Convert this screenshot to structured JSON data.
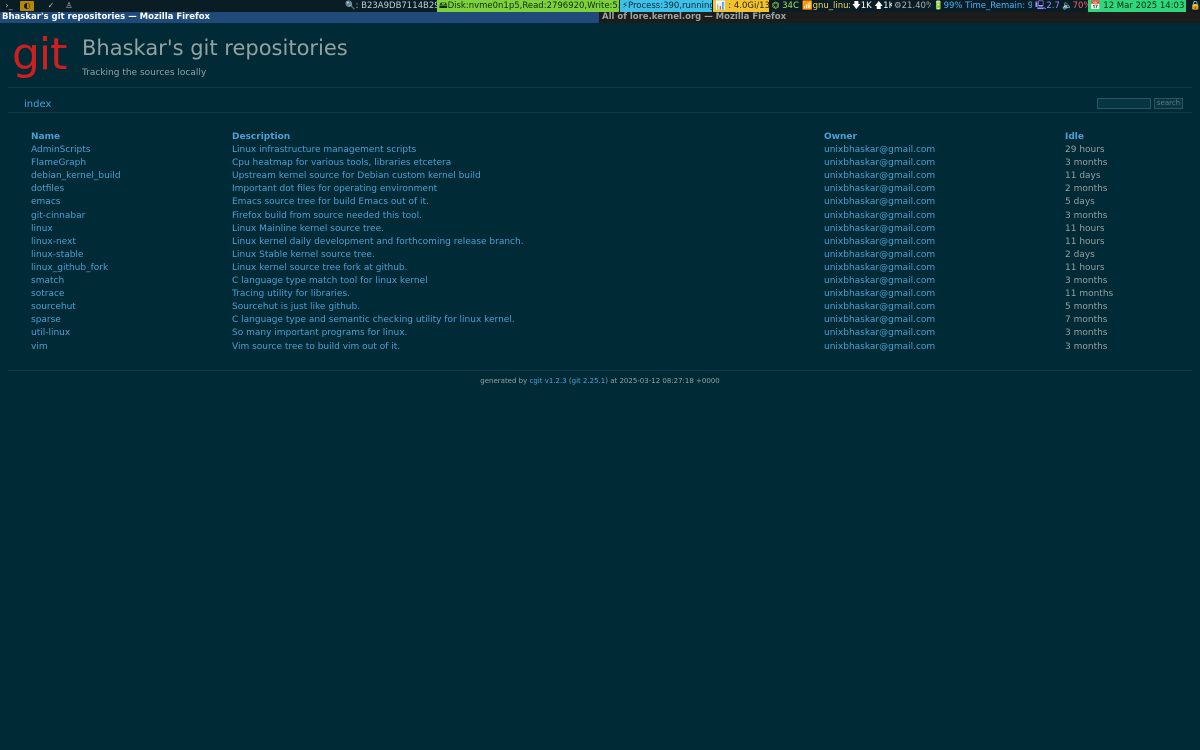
{
  "statusbar": {
    "tags": [
      "›_",
      "◐",
      "✓",
      "♙"
    ],
    "key": "🔍: B23A9DB7114B2915",
    "disk": "🖴Disk:nvme0n1p5,Read:2796920,Write:5322172",
    "process": "⚡Process:390,running:2",
    "memory": "📊 : 4.0Gi/13Gi",
    "temp": "⏣ 34C",
    "wifi": "📶gnu_linux1",
    "net": "🡇1K 🡅1K",
    "cpu": "⚙21.40%",
    "battery": "🔋99% Time_Remain: 99%",
    "load": "🖳2.75",
    "volume": "🔈70%",
    "clock": "📅 12 Mar 2025 14:03 Wed",
    "end_icon": "🔒"
  },
  "windows": {
    "active": "Bhaskar's git repositories — Mozilla Firefox",
    "inactive": "All of lore.kernel.org — Mozilla Firefox"
  },
  "header": {
    "logo": "git",
    "title": "Bhaskar's git repositories",
    "subtitle": "Tracking the sources locally"
  },
  "tabs": {
    "index": "index"
  },
  "search": {
    "button_label": "search",
    "value": ""
  },
  "table": {
    "headers": {
      "name": "Name",
      "description": "Description",
      "owner": "Owner",
      "idle": "Idle"
    },
    "rows": [
      {
        "name": "AdminScripts",
        "description": "Linux infrastructure management scripts",
        "owner": "unixbhaskar@gmail.com",
        "idle": "29 hours"
      },
      {
        "name": "FlameGraph",
        "description": "Cpu heatmap for various tools, libraries etcetera",
        "owner": "unixbhaskar@gmail.com",
        "idle": "3 months"
      },
      {
        "name": "debian_kernel_build",
        "description": "Upstream kernel source for Debian custom kernel build",
        "owner": "unixbhaskar@gmail.com",
        "idle": "11 days"
      },
      {
        "name": "dotfiles",
        "description": "Important dot files for operating environment",
        "owner": "unixbhaskar@gmail.com",
        "idle": "2 months"
      },
      {
        "name": "emacs",
        "description": "Emacs source tree for build Emacs out of it.",
        "owner": "unixbhaskar@gmail.com",
        "idle": "5 days"
      },
      {
        "name": "git-cinnabar",
        "description": "Firefox build from source needed this tool.",
        "owner": "unixbhaskar@gmail.com",
        "idle": "3 months"
      },
      {
        "name": "linux",
        "description": "Linux Mainline kernel source tree.",
        "owner": "unixbhaskar@gmail.com",
        "idle": "11 hours"
      },
      {
        "name": "linux-next",
        "description": "Linux kernel daily development and forthcoming release branch.",
        "owner": "unixbhaskar@gmail.com",
        "idle": "11 hours"
      },
      {
        "name": "linux-stable",
        "description": "Linux Stable kernel source tree.",
        "owner": "unixbhaskar@gmail.com",
        "idle": "2 days"
      },
      {
        "name": "linux_github_fork",
        "description": "Linux kernel source tree fork at github.",
        "owner": "unixbhaskar@gmail.com",
        "idle": "11 hours"
      },
      {
        "name": "smatch",
        "description": "C language type match tool for linux kernel",
        "owner": "unixbhaskar@gmail.com",
        "idle": "3 months"
      },
      {
        "name": "sotrace",
        "description": "Tracing utility for libraries.",
        "owner": "unixbhaskar@gmail.com",
        "idle": "11 months"
      },
      {
        "name": "sourcehut",
        "description": "Sourcehut is just like github.",
        "owner": "unixbhaskar@gmail.com",
        "idle": "5 months"
      },
      {
        "name": "sparse",
        "description": "C language type and semantic checking utility for linux kernel.",
        "owner": "unixbhaskar@gmail.com",
        "idle": "7 months"
      },
      {
        "name": "util-linux",
        "description": "So many important programs for linux.",
        "owner": "unixbhaskar@gmail.com",
        "idle": "3 months"
      },
      {
        "name": "vim",
        "description": "Vim source tree to build vim out of it.",
        "owner": "unixbhaskar@gmail.com",
        "idle": "3 months"
      }
    ]
  },
  "footer": {
    "prefix": "generated by ",
    "cgit_link": "cgit v1.2.3",
    "open_paren": " (",
    "git_link": "git 2.25.1",
    "suffix": ") at 2025-03-12 08:27:18 +0000"
  },
  "colors": {
    "background": "#002b36",
    "link": "#4f9fd6",
    "text": "#93a1a1",
    "logo": "#cc1f1f"
  }
}
